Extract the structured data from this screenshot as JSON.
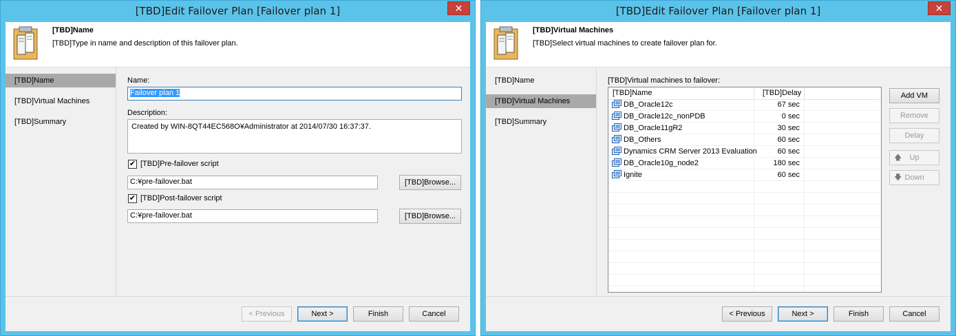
{
  "left_window": {
    "title": "[TBD]Edit Failover Plan [Failover plan 1]",
    "close_glyph": "✕",
    "header": {
      "title": "[TBD]Name",
      "description": "[TBD]Type in name and description of this failover plan.",
      "icon": "server-wizard-icon"
    },
    "nav": [
      "[TBD]Name",
      "[TBD]Virtual Machines",
      "[TBD]Summary"
    ],
    "active_nav": 0,
    "name_label": "Name:",
    "name_value": "Failover plan 1",
    "description_label": "Description:",
    "description_value": "Created by WIN-8QT44EC568O¥Administrator at 2014/07/30 16:37:37.",
    "pre_script_label": "[TBD]Pre-failover script",
    "pre_script_checked": true,
    "pre_script_value": "C:¥pre-failover.bat",
    "post_script_label": "[TBD]Post-failover script",
    "post_script_checked": true,
    "post_script_value": "C:¥pre-failover.bat",
    "browse_label": "[TBD]Browse...",
    "buttons": {
      "previous": "< Previous",
      "next": "Next >",
      "finish": "Finish",
      "cancel": "Cancel"
    }
  },
  "right_window": {
    "title": "[TBD]Edit Failover Plan [Failover plan 1]",
    "close_glyph": "✕",
    "header": {
      "title": "[TBD]Virtual Machines",
      "description": "[TBD]Select virtual machines to create failover plan for.",
      "icon": "server-wizard-icon"
    },
    "nav": [
      "[TBD]Name",
      "[TBD]Virtual Machines",
      "[TBD]Summary"
    ],
    "active_nav": 1,
    "list_label": "[TBD]Virtual machines to failover:",
    "columns": [
      "[TBD]Name",
      "[TBD]Delay"
    ],
    "vms": [
      {
        "name": "DB_Oracle12c",
        "delay": "67 sec"
      },
      {
        "name": "DB_Oracle12c_nonPDB",
        "delay": "0 sec"
      },
      {
        "name": "DB_Oracle11gR2",
        "delay": "30 sec"
      },
      {
        "name": "DB_Others",
        "delay": "60 sec"
      },
      {
        "name": "Dynamics CRM Server 2013 Evaluation",
        "delay": "60 sec"
      },
      {
        "name": "DB_Oracle10g_node2",
        "delay": "180 sec"
      },
      {
        "name": "Ignite",
        "delay": "60 sec"
      }
    ],
    "side_buttons": {
      "add": "Add VM",
      "remove": "Remove",
      "delay": "Delay",
      "up": "Up",
      "down": "Down"
    },
    "buttons": {
      "previous": "< Previous",
      "next": "Next >",
      "finish": "Finish",
      "cancel": "Cancel"
    }
  },
  "colors": {
    "frame": "#5bc3e9",
    "close": "#c7423a",
    "selection": "#3399ff",
    "nav_active": "#a9a9a9"
  }
}
